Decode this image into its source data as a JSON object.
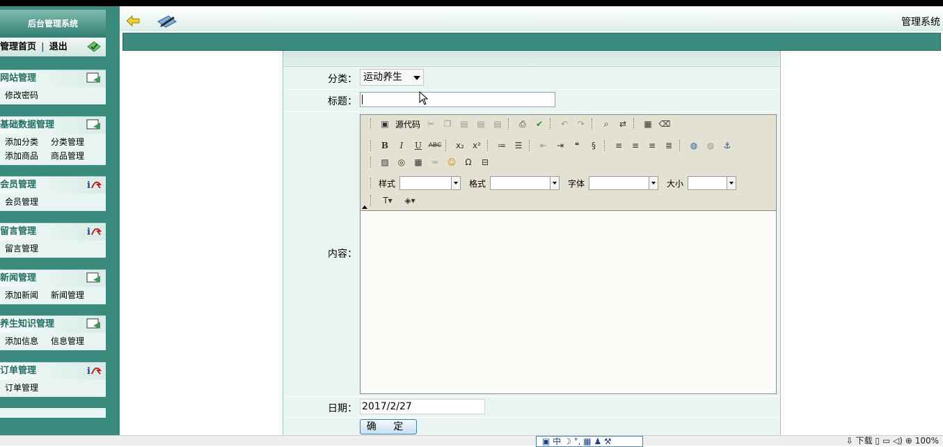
{
  "sidebar": {
    "title": "后台管理系统",
    "home": "管理首页",
    "logout": "退出",
    "sections": [
      {
        "title": "网站管理",
        "icon": "mail-screen-icon",
        "items": [
          "修改密码"
        ]
      },
      {
        "title": "基础数据管理",
        "icon": "mail-screen-icon",
        "items": [
          "添加分类",
          "分类管理",
          "添加商品",
          "商品管理"
        ]
      },
      {
        "title": "会员管理",
        "icon": "info-arrow-icon",
        "items": [
          "会员管理"
        ]
      },
      {
        "title": "留言管理",
        "icon": "info-arrow-icon",
        "items": [
          "留言管理"
        ]
      },
      {
        "title": "新闻管理",
        "icon": "mail-screen-icon",
        "items": [
          "添加新闻",
          "新闻管理"
        ]
      },
      {
        "title": "养生知识管理",
        "icon": "mail-screen-icon",
        "items": [
          "添加信息",
          "信息管理"
        ]
      },
      {
        "title": "订单管理",
        "icon": "info-arrow-icon",
        "items": [
          "订单管理"
        ]
      }
    ]
  },
  "header": {
    "system_title": "管理系统"
  },
  "form": {
    "category_label": "分类：",
    "category_value": "运动养生",
    "title_label": "标题：",
    "title_value": "",
    "content_label": "内容：",
    "date_label": "日期：",
    "date_value": "2017/2/27",
    "submit_label": "确 定"
  },
  "editor": {
    "source_label": "源代码",
    "style_label": "样式",
    "format_label": "格式",
    "font_label": "字体",
    "size_label": "大小"
  },
  "statusbar": {
    "ime_text": "中",
    "download_label": "下载",
    "zoom": "100%"
  }
}
